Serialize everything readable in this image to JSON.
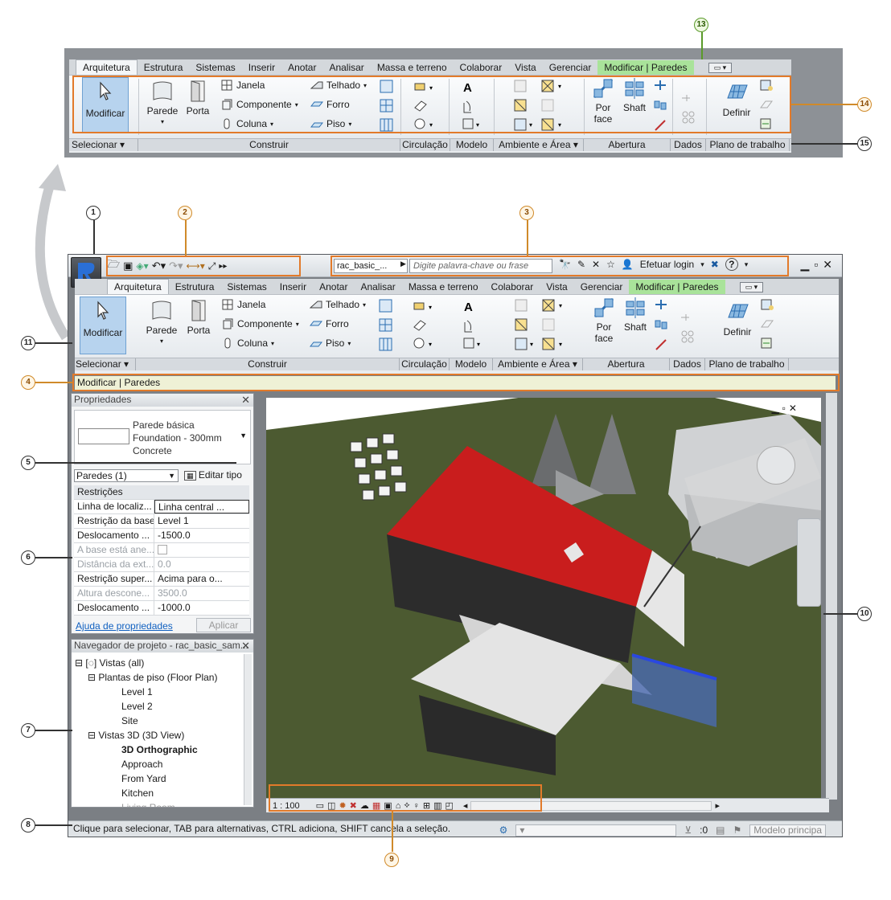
{
  "ribbon": {
    "tabs": [
      "Arquitetura",
      "Estrutura",
      "Sistemas",
      "Inserir",
      "Anotar",
      "Analisar",
      "Massa e terreno",
      "Colaborar",
      "Vista",
      "Gerenciar",
      "Modificar | Paredes"
    ],
    "modify_label": "Modificar",
    "build": {
      "wall": "Parede",
      "door": "Porta",
      "window": "Janela",
      "component": "Componente",
      "column": "Coluna",
      "roof": "Telhado",
      "ceiling": "Forro",
      "floor": "Piso"
    },
    "opening": {
      "by_face_1": "Por",
      "by_face_2": "face",
      "shaft": "Shaft"
    },
    "workplane": {
      "set": "Definir"
    },
    "panels": [
      "Selecionar ▾",
      "Construir",
      "Circulação",
      "Modelo",
      "Ambiente e Área ▾",
      "Abertura",
      "Dados",
      "Plano de trabalho"
    ]
  },
  "titlebar": {
    "doc_name": "rac_basic_...",
    "search_placeholder": "Digite palavra-chave ou frase",
    "login": "Efetuar login",
    "help": "?"
  },
  "options_bar": "Modificar | Paredes",
  "properties": {
    "title": "Propriedades",
    "type_line1": "Parede básica",
    "type_line2": "Foundation - 300mm",
    "type_line3": "Concrete",
    "instance_filter": "Paredes (1)",
    "edit_type": "Editar tipo",
    "group": "Restrições",
    "rows": [
      {
        "k": "Linha de localiz...",
        "v": "Linha central ..."
      },
      {
        "k": "Restrição da base",
        "v": "Level 1"
      },
      {
        "k": "Deslocamento ...",
        "v": "-1500.0"
      },
      {
        "k": "A base está ane...",
        "v": ""
      },
      {
        "k": "Distância da ext...",
        "v": "0.0"
      },
      {
        "k": "Restrição super...",
        "v": "Acima para o..."
      },
      {
        "k": "Altura descone...",
        "v": "3500.0"
      },
      {
        "k": "Deslocamento ...",
        "v": "-1000.0"
      }
    ],
    "help_link": "Ajuda de propriedades",
    "apply": "Aplicar"
  },
  "browser": {
    "title": "Navegador de projeto - rac_basic_sam...",
    "views_all": "Vistas (all)",
    "floor_plans": "Plantas de piso (Floor Plan)",
    "fp": [
      "Level 1",
      "Level 2",
      "Site"
    ],
    "views_3d": "Vistas 3D (3D View)",
    "v3d": [
      "3D Orthographic",
      "Approach",
      "From Yard",
      "Kitchen",
      "Living Room"
    ]
  },
  "view_bar": {
    "scale": "1 : 100"
  },
  "status": {
    "hint": "Clique para selecionar, TAB para alternativas, CTRL adiciona, SHIFT cancela a seleção.",
    "count": ":0",
    "model": "Modelo principa"
  },
  "callouts": [
    "1",
    "2",
    "3",
    "4",
    "5",
    "6",
    "7",
    "8",
    "9",
    "10",
    "11",
    "13",
    "14",
    "15"
  ],
  "colors": {
    "highlight": "#e27a2a",
    "context_tab": "#a9e39a",
    "roof": "#cc1f1f",
    "ground": "#4a5a2e"
  }
}
